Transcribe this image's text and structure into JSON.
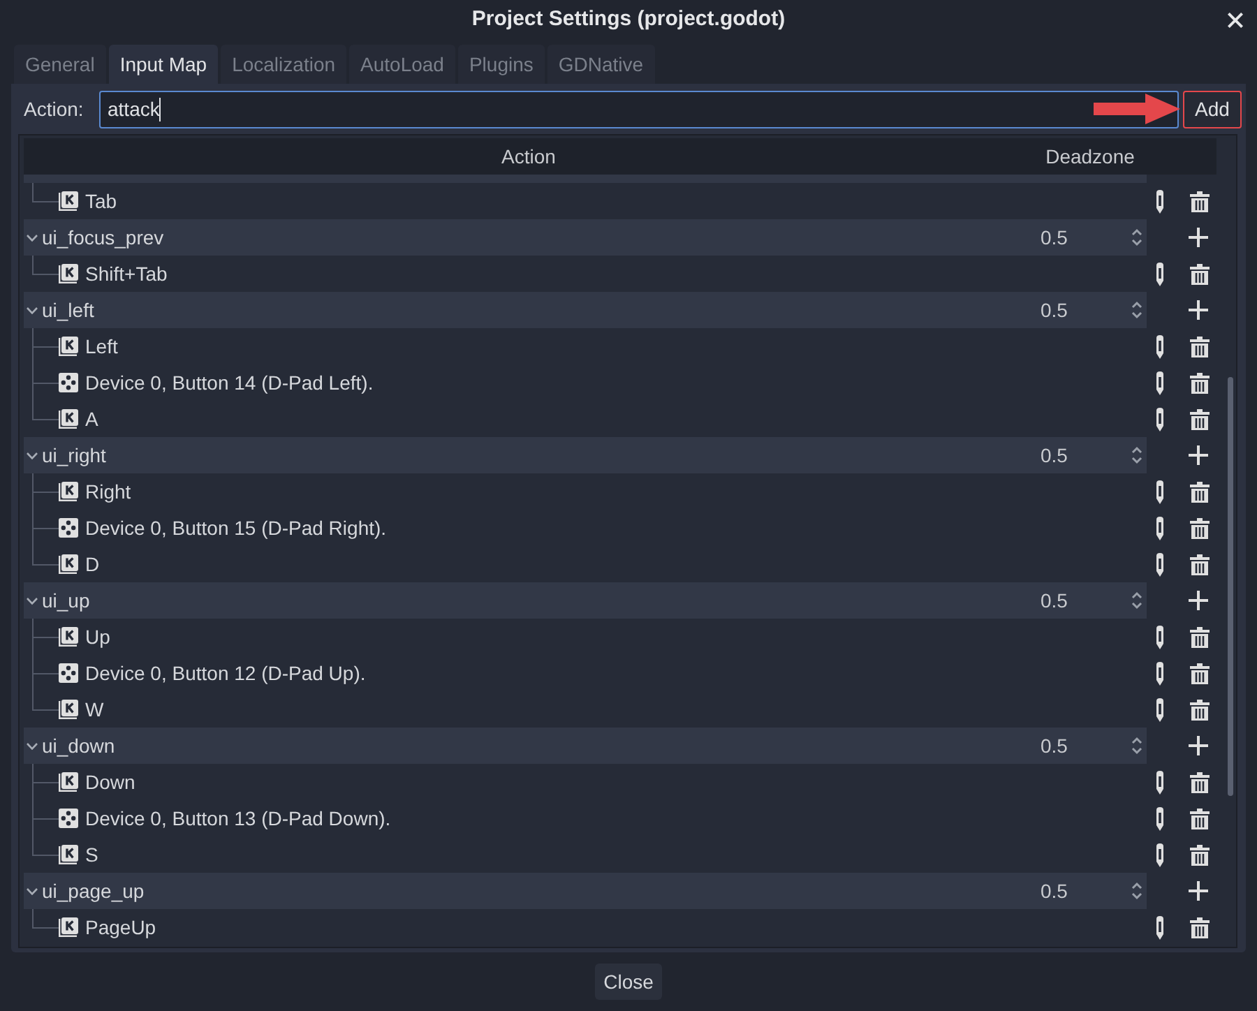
{
  "window": {
    "title": "Project Settings (project.godot)"
  },
  "tabs": [
    {
      "label": "General",
      "selected": false
    },
    {
      "label": "Input Map",
      "selected": true
    },
    {
      "label": "Localization",
      "selected": false
    },
    {
      "label": "AutoLoad",
      "selected": false
    },
    {
      "label": "Plugins",
      "selected": false
    },
    {
      "label": "GDNative",
      "selected": false
    }
  ],
  "action_bar": {
    "label": "Action:",
    "field": {
      "value": "attack",
      "focused": true
    },
    "add_button": {
      "label": "Add",
      "highlighted": true
    }
  },
  "tree": {
    "columns": [
      "Action",
      "Deadzone"
    ],
    "actions": [
      {
        "children": [
          {
            "kind": "key",
            "label": "Tab"
          }
        ]
      },
      {
        "name": "ui_focus_prev",
        "expanded": true,
        "deadzone": "0.5",
        "children": [
          {
            "kind": "key",
            "label": "Shift+Tab"
          }
        ]
      },
      {
        "name": "ui_left",
        "expanded": true,
        "deadzone": "0.5",
        "children": [
          {
            "kind": "key",
            "label": "Left"
          },
          {
            "kind": "joypad_button",
            "label": "Device 0, Button 14 (D-Pad Left)."
          },
          {
            "kind": "key",
            "label": "A"
          }
        ]
      },
      {
        "name": "ui_right",
        "expanded": true,
        "deadzone": "0.5",
        "children": [
          {
            "kind": "key",
            "label": "Right"
          },
          {
            "kind": "joypad_button",
            "label": "Device 0, Button 15 (D-Pad Right)."
          },
          {
            "kind": "key",
            "label": "D"
          }
        ]
      },
      {
        "name": "ui_up",
        "expanded": true,
        "deadzone": "0.5",
        "children": [
          {
            "kind": "key",
            "label": "Up"
          },
          {
            "kind": "joypad_button",
            "label": "Device 0, Button 12 (D-Pad Up)."
          },
          {
            "kind": "key",
            "label": "W"
          }
        ]
      },
      {
        "name": "ui_down",
        "expanded": true,
        "deadzone": "0.5",
        "children": [
          {
            "kind": "key",
            "label": "Down"
          },
          {
            "kind": "joypad_button",
            "label": "Device 0, Button 13 (D-Pad Down)."
          },
          {
            "kind": "key",
            "label": "S"
          }
        ]
      },
      {
        "name": "ui_page_up",
        "expanded": true,
        "deadzone": "0.5",
        "children": [
          {
            "kind": "key",
            "label": "PageUp"
          }
        ]
      }
    ]
  },
  "close_button": {
    "label": "Close"
  }
}
